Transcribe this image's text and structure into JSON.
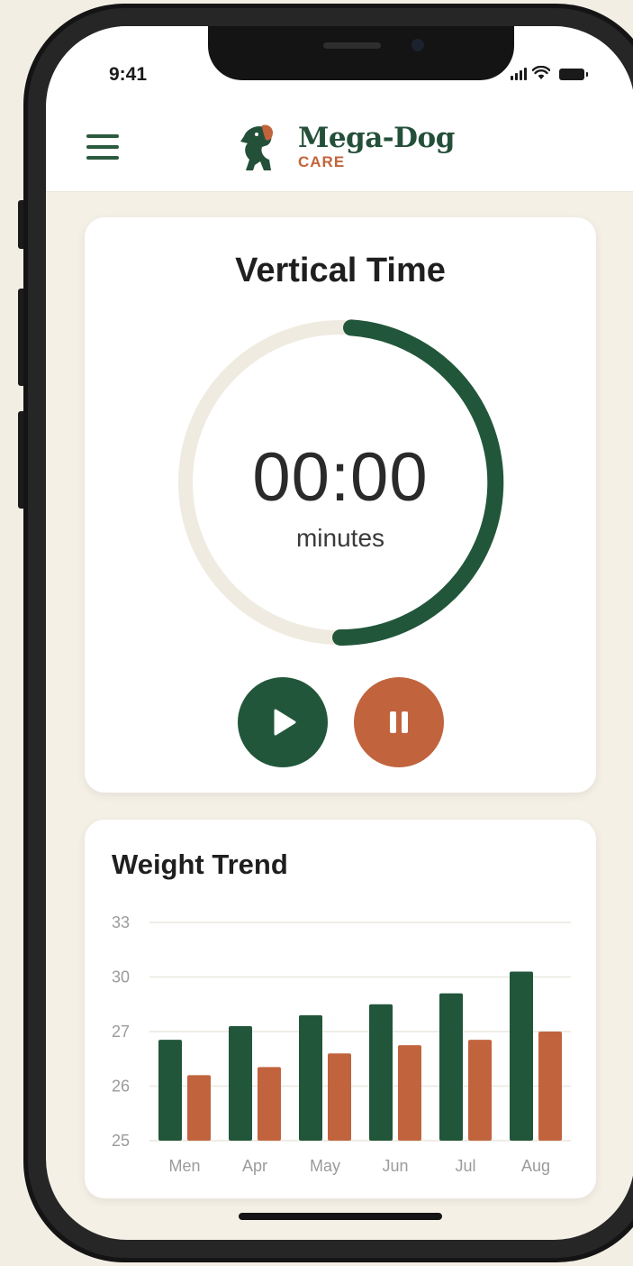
{
  "status_bar": {
    "time": "9:41"
  },
  "app": {
    "brand_name": "Mega-Dog",
    "brand_sub": "CARE",
    "colors": {
      "green": "#21563a",
      "orange": "#c1643e",
      "cream": "#f4f0e6"
    }
  },
  "timer": {
    "title": "Vertical Time",
    "value": "00:00",
    "unit": "minutes",
    "progress": 0.5,
    "play_icon": "play-icon",
    "pause_icon": "pause-icon"
  },
  "weight": {
    "title": "Weight Trend"
  },
  "chart_data": {
    "type": "bar",
    "categories": [
      "Men",
      "Apr",
      "May",
      "Jun",
      "Jul",
      "Aug"
    ],
    "y_ticks": [
      "33",
      "30",
      "27",
      "26",
      "25"
    ],
    "series": [
      {
        "values": [
          28.7,
          29.2,
          29.6,
          30.0,
          30.4,
          31.2
        ],
        "color": "#21563a"
      },
      {
        "values": [
          27.4,
          27.7,
          28.2,
          28.5,
          28.7,
          29.0
        ],
        "color": "#c1643e"
      }
    ],
    "ylim": [
      25,
      33
    ],
    "grid": true
  }
}
